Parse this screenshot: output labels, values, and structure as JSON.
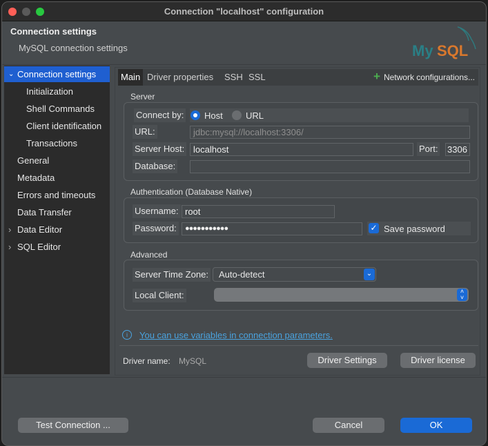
{
  "window": {
    "title": "Connection \"localhost\" configuration"
  },
  "header": {
    "title": "Connection settings",
    "subtitle": "MySQL connection settings",
    "logo_text": "MySQL"
  },
  "sidebar": {
    "items": [
      {
        "label": "Connection settings",
        "expanded": true,
        "selected": true
      },
      {
        "label": "Initialization"
      },
      {
        "label": "Shell Commands"
      },
      {
        "label": "Client identification"
      },
      {
        "label": "Transactions"
      },
      {
        "label": "General"
      },
      {
        "label": "Metadata"
      },
      {
        "label": "Errors and timeouts"
      },
      {
        "label": "Data Transfer"
      },
      {
        "label": "Data Editor",
        "expandable": true
      },
      {
        "label": "SQL Editor",
        "expandable": true
      }
    ]
  },
  "tabs": [
    {
      "label": "Main",
      "active": true
    },
    {
      "label": "Driver properties"
    },
    {
      "label": "SSH"
    },
    {
      "label": "SSL"
    }
  ],
  "network_config": "Network configurations...",
  "server": {
    "title": "Server",
    "connect_by_label": "Connect by:",
    "host_option": "Host",
    "url_option": "URL",
    "connect_by": "Host",
    "url_label": "URL:",
    "url_value": "jdbc:mysql://localhost:3306/",
    "host_label": "Server Host:",
    "host_value": "localhost",
    "port_label": "Port:",
    "port_value": "3306",
    "database_label": "Database:",
    "database_value": ""
  },
  "auth": {
    "title": "Authentication (Database Native)",
    "username_label": "Username:",
    "username_value": "root",
    "password_label": "Password:",
    "password_value": "●●●●●●●●●●●",
    "save_password_label": "Save password",
    "save_password": true
  },
  "advanced": {
    "title": "Advanced",
    "timezone_label": "Server Time Zone:",
    "timezone_value": "Auto-detect",
    "local_client_label": "Local Client:",
    "local_client_value": ""
  },
  "info_link": "You can use variables in connection parameters.",
  "driver": {
    "name_label": "Driver name:",
    "name_value": "MySQL",
    "settings_button": "Driver Settings",
    "license_button": "Driver license"
  },
  "footer": {
    "test_button": "Test Connection ...",
    "cancel_button": "Cancel",
    "ok_button": "OK"
  },
  "colors": {
    "accent": "#1a6ad6",
    "link": "#4aa3df",
    "sidebar_selected": "#1f5fd0"
  }
}
